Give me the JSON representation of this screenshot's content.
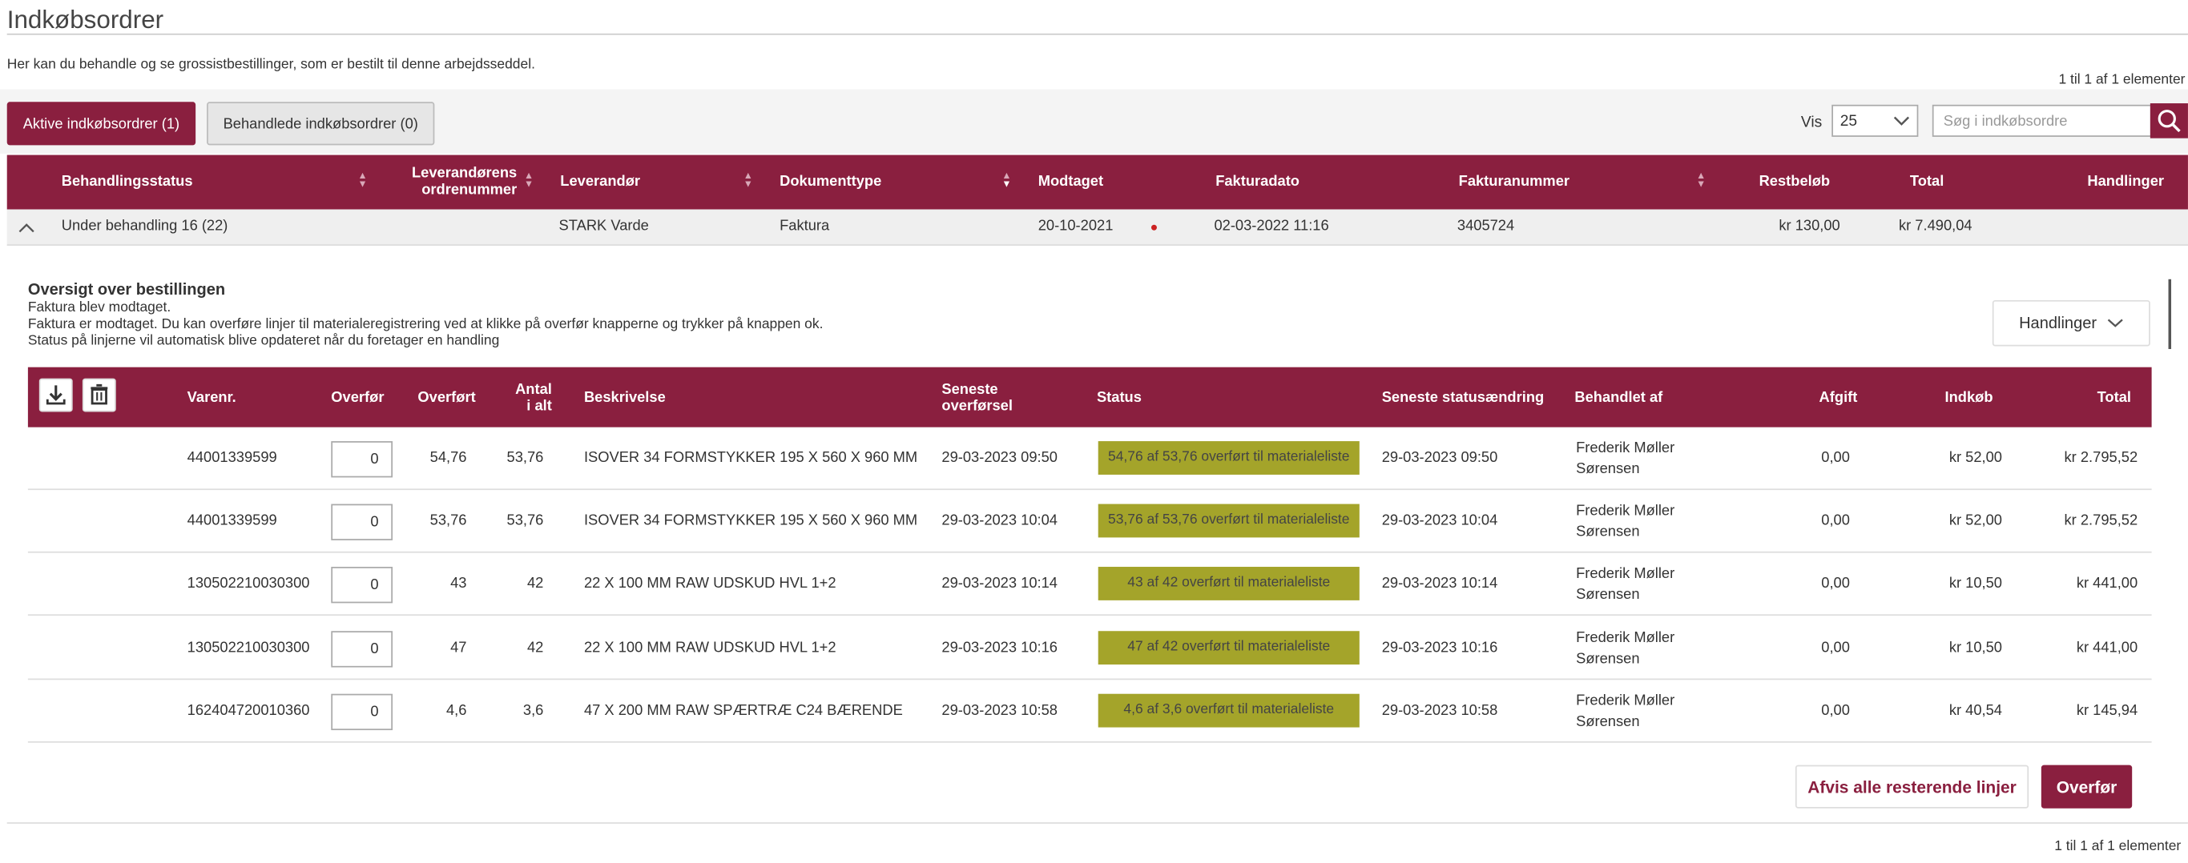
{
  "page": {
    "title": "Indkøbsordrer",
    "intro": "Her kan du behandle og se grossistbestillinger, som er bestilt til denne arbejdsseddel.",
    "count_top": "1 til 1 af 1 elementer",
    "count_bottom": "1 til 1 af 1 elementer"
  },
  "tabs": {
    "active_label": "Aktive indkøbsordrer (1)",
    "inactive_label": "Behandlede indkøbsordrer (0)"
  },
  "filter": {
    "vis_label": "Vis",
    "page_size": "25",
    "search_placeholder": "Søg i indkøbsordre"
  },
  "orders_table": {
    "headers": {
      "status": "Behandlingsstatus",
      "supplier_order_1": "Leverandørens",
      "supplier_order_2": "ordrenummer",
      "supplier": "Leverandør",
      "doc_type": "Dokumenttype",
      "received": "Modtaget",
      "invoice_date": "Fakturadato",
      "invoice_no": "Fakturanummer",
      "remaining": "Restbeløb",
      "total": "Total",
      "actions": "Handlinger"
    },
    "row": {
      "status": "Under behandling 16 (22)",
      "supplier": "STARK Varde",
      "doc_type": "Faktura",
      "received": "20-10-2021",
      "invoice_date": "02-03-2022 11:16",
      "invoice_no": "3405724",
      "remaining": "kr 130,00",
      "total": "kr 7.490,04"
    }
  },
  "overview": {
    "title": "Oversigt over bestillingen",
    "line1": "Faktura blev modtaget.",
    "line2": "Faktura er modtaget. Du kan overføre linjer til materialeregistrering ved at klikke på overfør knapperne og trykker på knappen ok.",
    "line3": "Status på linjerne vil automatisk blive opdateret når du foretager en handling",
    "actions_label": "Handlinger"
  },
  "items_table": {
    "headers": {
      "item_no": "Varenr.",
      "transfer": "Overfør",
      "transferred": "Overført",
      "total_qty_1": "Antal",
      "total_qty_2": "i alt",
      "description": "Beskrivelse",
      "last_transfer_1": "Seneste",
      "last_transfer_2": "overførsel",
      "status": "Status",
      "last_status_change": "Seneste statusændring",
      "handled_by": "Behandlet af",
      "fee": "Afgift",
      "purchase": "Indkøb",
      "total": "Total"
    },
    "rows": [
      {
        "item_no": "44001339599",
        "transfer": "0",
        "transferred": "54,76",
        "total_qty": "53,76",
        "description": "ISOVER 34 FORMSTYKKER 195 X 560 X 960 MM",
        "last_transfer": "29-03-2023 09:50",
        "status": "54,76 af 53,76 overført til materialeliste",
        "last_status_change": "29-03-2023 09:50",
        "handled_by_1": "Frederik Møller",
        "handled_by_2": "Sørensen",
        "fee": "0,00",
        "purchase": "kr 52,00",
        "total": "kr 2.795,52"
      },
      {
        "item_no": "44001339599",
        "transfer": "0",
        "transferred": "53,76",
        "total_qty": "53,76",
        "description": "ISOVER 34 FORMSTYKKER 195 X 560 X 960 MM",
        "last_transfer": "29-03-2023 10:04",
        "status": "53,76 af 53,76 overført til materialeliste",
        "last_status_change": "29-03-2023 10:04",
        "handled_by_1": "Frederik Møller",
        "handled_by_2": "Sørensen",
        "fee": "0,00",
        "purchase": "kr 52,00",
        "total": "kr 2.795,52"
      },
      {
        "item_no": "130502210030300",
        "transfer": "0",
        "transferred": "43",
        "total_qty": "42",
        "description": "22 X 100 MM RAW UDSKUD HVL 1+2",
        "last_transfer": "29-03-2023 10:14",
        "status": "43 af 42 overført til materialeliste",
        "last_status_change": "29-03-2023 10:14",
        "handled_by_1": "Frederik Møller",
        "handled_by_2": "Sørensen",
        "fee": "0,00",
        "purchase": "kr 10,50",
        "total": "kr 441,00"
      },
      {
        "item_no": "130502210030300",
        "transfer": "0",
        "transferred": "47",
        "total_qty": "42",
        "description": "22 X 100 MM RAW UDSKUD HVL 1+2",
        "last_transfer": "29-03-2023 10:16",
        "status": "47 af 42 overført til materialeliste",
        "last_status_change": "29-03-2023 10:16",
        "handled_by_1": "Frederik Møller",
        "handled_by_2": "Sørensen",
        "fee": "0,00",
        "purchase": "kr 10,50",
        "total": "kr 441,00"
      },
      {
        "item_no": "162404720010360",
        "transfer": "0",
        "transferred": "4,6",
        "total_qty": "3,6",
        "description": "47 X 200 MM RAW SPÆRTRÆ C24 BÆRENDE",
        "last_transfer": "29-03-2023 10:58",
        "status": "4,6 af 3,6 overført til materialeliste",
        "last_status_change": "29-03-2023 10:58",
        "handled_by_1": "Frederik Møller",
        "handled_by_2": "Sørensen",
        "fee": "0,00",
        "purchase": "kr 40,54",
        "total": "kr 145,94"
      }
    ]
  },
  "footer_actions": {
    "reject_label": "Afvis alle resterende linjer",
    "transfer_label": "Overfør"
  },
  "colors": {
    "brand": "#8a1f3f",
    "status_badge": "#a4a42a",
    "toolbar_bg": "#f4f4f4",
    "summary_row_bg": "#efefef",
    "date_dot": "#cc2222"
  },
  "icons": {
    "select_chevron": "chevron-down-icon",
    "search": "search-icon",
    "collapse": "chevron-up-icon",
    "date_marker": "dot-icon",
    "actions_chevron": "chevron-down-icon",
    "download": "download-icon",
    "delete": "trash-icon"
  }
}
